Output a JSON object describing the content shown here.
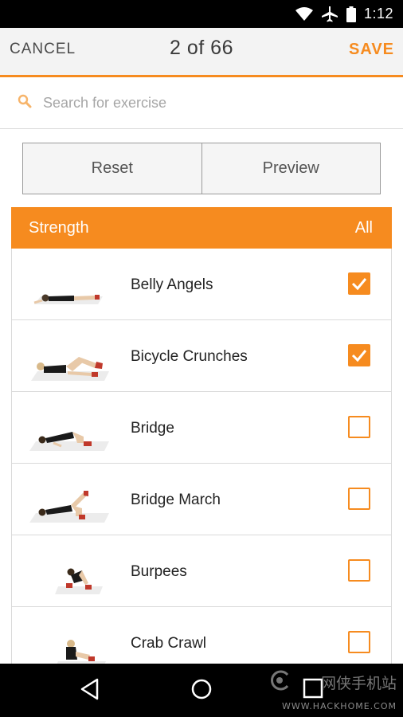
{
  "status_bar": {
    "time": "1:12",
    "icons": [
      "wifi-icon",
      "airplane-mode-icon",
      "battery-icon"
    ]
  },
  "action_bar": {
    "cancel_label": "CANCEL",
    "counter": "2 of 66",
    "save_label": "SAVE"
  },
  "search": {
    "placeholder": "Search for exercise",
    "value": ""
  },
  "buttons": {
    "reset_label": "Reset",
    "preview_label": "Preview"
  },
  "category": {
    "name": "Strength",
    "select_all_label": "All"
  },
  "exercises": [
    {
      "name": "Belly Angels",
      "checked": true
    },
    {
      "name": "Bicycle Crunches",
      "checked": true
    },
    {
      "name": "Bridge",
      "checked": false
    },
    {
      "name": "Bridge March",
      "checked": false
    },
    {
      "name": "Burpees",
      "checked": false
    },
    {
      "name": "Crab Crawl",
      "checked": false
    }
  ],
  "nav_bar": {
    "buttons": [
      "back-icon",
      "home-icon",
      "recents-icon"
    ]
  },
  "watermark": {
    "brand_cn": "网侠手机站",
    "url": "WWW.HACKHOME.COM"
  },
  "colors": {
    "accent": "#f68b1f",
    "status_bar": "#000000",
    "action_bar": "#f3f3f3"
  }
}
